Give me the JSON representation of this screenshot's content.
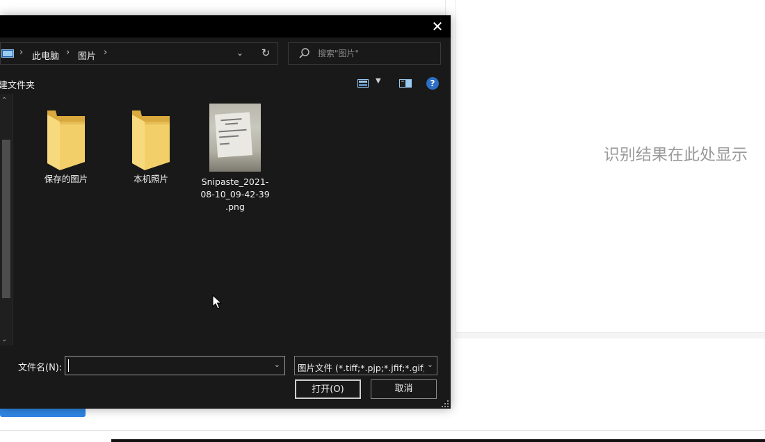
{
  "background": {
    "result_placeholder": "识别结果在此处显示"
  },
  "dialog": {
    "close_label": "✕",
    "address": {
      "crumbs": [
        "此电脑",
        "图片"
      ],
      "separator": "›",
      "dropdown_icon": "chevron-down-icon",
      "refresh_icon": "refresh-icon"
    },
    "search": {
      "placeholder": "搜索\"图片\""
    },
    "toolbar": {
      "new_folder_label": "建文件夹",
      "help_label": "?"
    },
    "items": [
      {
        "label": "保存的图片",
        "icon": "folder-icon"
      },
      {
        "label": "本机照片",
        "icon": "folder-icon"
      },
      {
        "label_lines": [
          "Snipaste_2021-",
          "08-10_09-42-39",
          ".png"
        ],
        "icon": "image-thumbnail"
      }
    ],
    "bottom": {
      "filename_label": "文件名(N):",
      "filename_value": "",
      "filter_value": "图片文件 (*.tiff;*.pjp;*.jfif;*.gif;",
      "open_label": "打开(O)",
      "cancel_label": "取消"
    }
  },
  "colors": {
    "dialog_bg": "#191919",
    "titlebar_bg": "#000000",
    "help_blue": "#2c6fc4",
    "folder_yellow": "#f3cf6a",
    "accent_blue": "#2f86e6"
  }
}
